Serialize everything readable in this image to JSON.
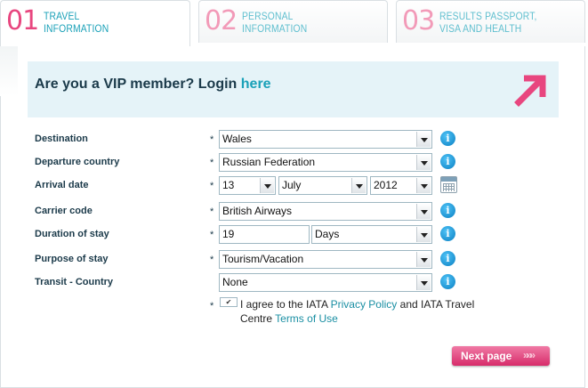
{
  "tabs": [
    {
      "num": "01",
      "line1": "TRAVEL",
      "line2": "INFORMATION"
    },
    {
      "num": "02",
      "line1": "PERSONAL",
      "line2": "INFORMATION"
    },
    {
      "num": "03",
      "line1": "RESULTS PASSPORT,",
      "line2": "VISA AND HEALTH"
    }
  ],
  "vip": {
    "text": "Are you a VIP member? Login ",
    "link": "here"
  },
  "form": {
    "required_mark": "*",
    "destination": {
      "label": "Destination",
      "value": "Wales"
    },
    "departure_country": {
      "label": "Departure country",
      "value": "Russian Federation"
    },
    "arrival_date": {
      "label": "Arrival date",
      "day": "13",
      "month": "July",
      "year": "2012"
    },
    "carrier_code": {
      "label": "Carrier code",
      "value": "British Airways"
    },
    "duration": {
      "label": "Duration of stay",
      "value": "19",
      "unit": "Days"
    },
    "purpose": {
      "label": "Purpose of stay",
      "value": "Tourism/Vacation"
    },
    "transit": {
      "label": "Transit - Country",
      "value": "None"
    },
    "agree": {
      "checkbox_mark": "✔",
      "prefix": "I agree to the IATA ",
      "privacy_link": "Privacy Policy",
      "middle": " and IATA Travel Centre ",
      "terms_link": "Terms of Use"
    }
  },
  "info_glyph": "i",
  "next_button": {
    "label": "Next page",
    "arrows": "»»»"
  },
  "colors": {
    "accent_pink": "#e8467f",
    "accent_teal": "#1aa1b8",
    "vip_bg": "#e5f3f8"
  }
}
